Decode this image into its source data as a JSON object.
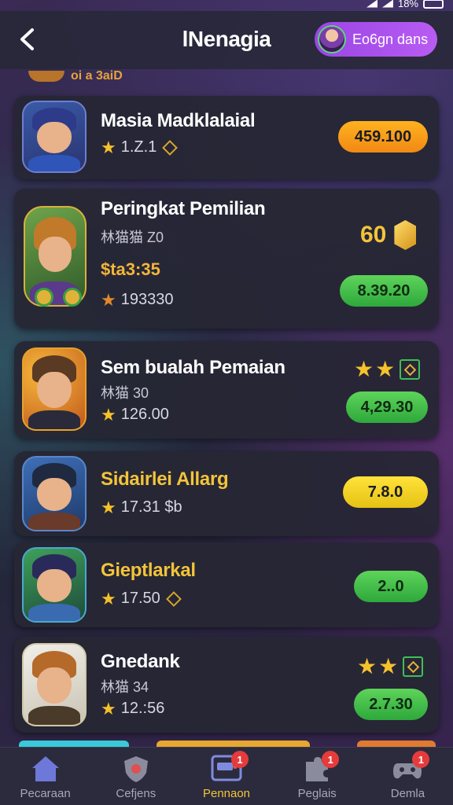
{
  "status_bar": {
    "battery": "18%"
  },
  "header": {
    "title": "lNenagia",
    "back_icon": "chevron-left-icon",
    "profile_pill_label": "Eo6gn dans"
  },
  "peek_top_text": "oi a 3aiD",
  "players": [
    {
      "name": "Masia Madklalaial",
      "sub": "",
      "stat": "1.Z.1",
      "price": "",
      "button": "459.100",
      "button_color": "#f59b18",
      "rating": "",
      "stars": 0
    },
    {
      "name": "Peringkat Pemilian",
      "sub": "林猫猫 Z0",
      "price": "$ta3:35",
      "stat": "193330",
      "button": "8.39.20",
      "button_color": "#3fb84a",
      "rating": "60",
      "stars": 0
    },
    {
      "name": "Sem bualah Pemaian",
      "sub": "林猫 30",
      "stat": "126.00",
      "price": "",
      "button": "4,29.30",
      "button_color": "#3fb84a",
      "rating": "",
      "stars": 2
    },
    {
      "name": "Sidairlei Allarg",
      "sub": "",
      "stat": "17.31 $b",
      "price": "",
      "button": "7.8.0",
      "button_color": "#f0d020",
      "rating": "",
      "stars": 0
    },
    {
      "name": "Gieptlarkal",
      "sub": "",
      "stat": "17.50",
      "price": "",
      "button": "2..0",
      "button_color": "#3fb84a",
      "rating": "",
      "stars": 0
    },
    {
      "name": "Gnedank",
      "sub": "林猫 34",
      "stat": "12.:56",
      "price": "",
      "button": "2.7.30",
      "button_color": "#3fb84a",
      "rating": "",
      "stars": 2
    }
  ],
  "bottom_nav": [
    {
      "label": "Pecaraan",
      "icon": "home-icon",
      "badge": ""
    },
    {
      "label": "Cefjens",
      "icon": "shield-icon",
      "badge": ""
    },
    {
      "label": "Pennaon",
      "icon": "chat-icon",
      "badge": "1"
    },
    {
      "label": "Peglais",
      "icon": "puzzle-icon",
      "badge": "1"
    },
    {
      "label": "Demla",
      "icon": "gamepad-icon",
      "badge": "1"
    }
  ]
}
